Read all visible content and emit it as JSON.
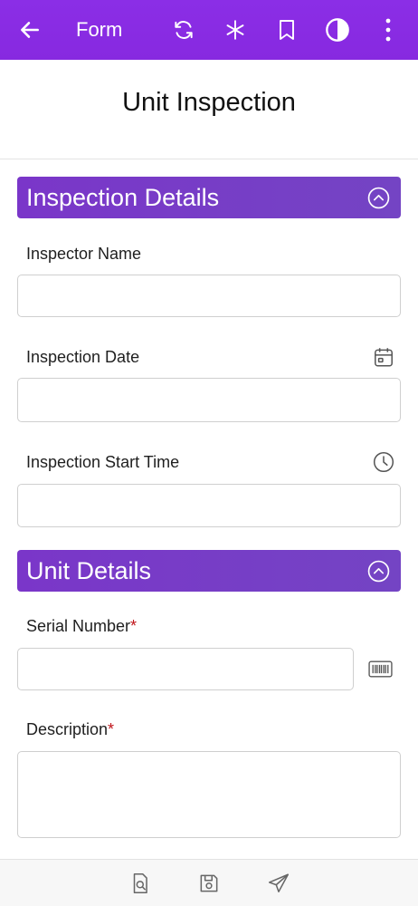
{
  "appbar": {
    "title": "Form",
    "icons": [
      "back-arrow-icon",
      "refresh-icon",
      "asterisk-icon",
      "bookmark-icon",
      "contrast-icon",
      "more-vert-icon"
    ],
    "color": "#8a2be2"
  },
  "page": {
    "title": "Unit Inspection"
  },
  "sections": {
    "inspection_details": {
      "title": "Inspection Details",
      "fields": {
        "inspector_name": {
          "label": "Inspector Name",
          "value": ""
        },
        "inspection_date": {
          "label": "Inspection Date",
          "value": ""
        },
        "inspection_start_time": {
          "label": "Inspection Start Time",
          "value": ""
        }
      }
    },
    "unit_details": {
      "title": "Unit Details",
      "fields": {
        "serial_number": {
          "label": "Serial Number",
          "required_mark": "*",
          "value": ""
        },
        "description": {
          "label": "Description",
          "required_mark": "*",
          "value": ""
        }
      }
    }
  },
  "bottom_bar": {
    "icons": [
      "search-document-icon",
      "save-icon",
      "send-icon"
    ]
  },
  "colors": {
    "section_header": "#7a3dc8",
    "required": "#c0151b"
  }
}
